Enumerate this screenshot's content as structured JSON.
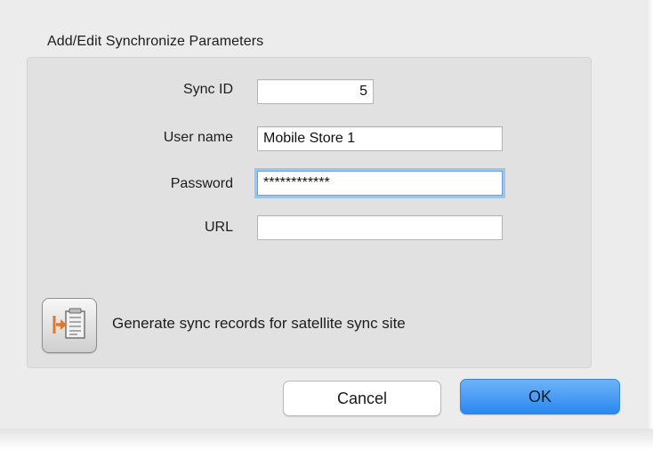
{
  "dialog": {
    "group_title": "Add/Edit Synchronize Parameters"
  },
  "fields": {
    "sync_id": {
      "label": "Sync ID",
      "value": "5"
    },
    "user_name": {
      "label": "User name",
      "value": "Mobile Store 1"
    },
    "password": {
      "label": "Password",
      "value": "************"
    },
    "url": {
      "label": "URL",
      "value": ""
    }
  },
  "sync_records": {
    "icon": "generate-records-icon",
    "label": "Generate sync records for satellite sync site"
  },
  "buttons": {
    "cancel": "Cancel",
    "ok": "OK"
  },
  "colors": {
    "ok_button": "#3a8ff2",
    "focus_ring": "#9fc4ea",
    "icon_arrow": "#e2762c"
  }
}
